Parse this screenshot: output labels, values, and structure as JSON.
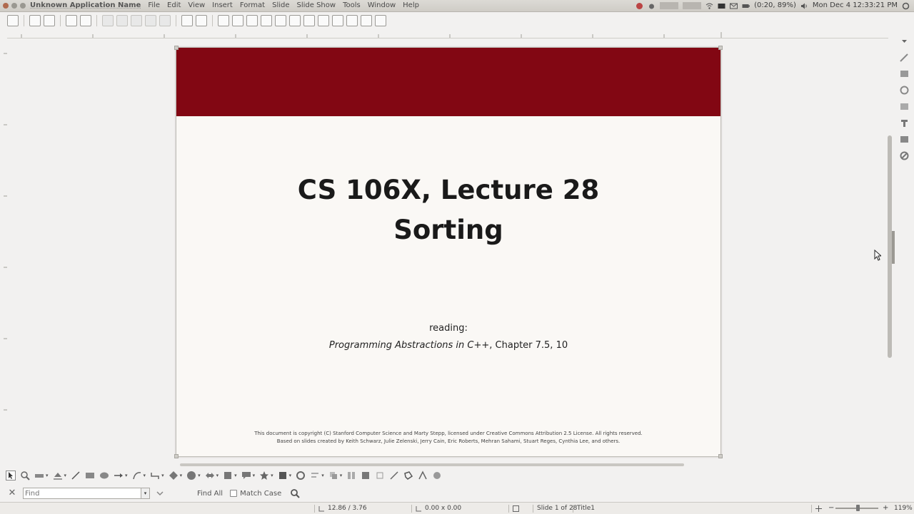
{
  "menubar": {
    "app_name": "Unknown Application Name",
    "menus": [
      "File",
      "Edit",
      "View",
      "Insert",
      "Format",
      "Slide",
      "Slide Show",
      "Tools",
      "Window",
      "Help"
    ],
    "battery": "(0:20, 89%)",
    "clock": "Mon Dec 4  12:33:21 PM"
  },
  "slide": {
    "band_color": "#820713",
    "title_line1": "CS 106X, Lecture 28",
    "title_line2": "Sorting",
    "reading_label": "reading:",
    "reading_book": "Programming Abstractions in C++",
    "reading_chapter": ", Chapter 7.5, 10",
    "footer_line1": "This document is copyright (C) Stanford Computer Science and Marty Stepp, licensed under Creative Commons Attribution 2.5 License.  All rights reserved.",
    "footer_line2": "Based on slides created by Keith Schwarz, Julie Zelenski, Jerry Cain, Eric Roberts, Mehran Sahami, Stuart Reges, Cynthia Lee, and others."
  },
  "findbar": {
    "placeholder": "Find",
    "find_all": "Find All",
    "match_case": "Match Case"
  },
  "statusbar": {
    "position": "12.86 / 3.76",
    "size": "0.00 x 0.00",
    "slide_counter": "Slide 1 of 28",
    "layout": "Title1",
    "zoom": "119%"
  }
}
